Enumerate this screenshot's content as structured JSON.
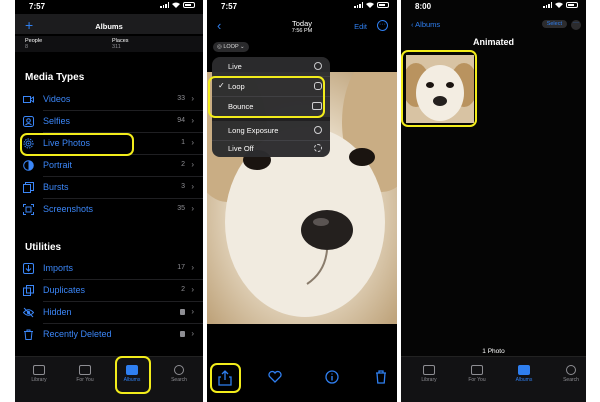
{
  "phone1": {
    "status_time": "7:57",
    "nav_title": "Albums",
    "summary": [
      {
        "label": "People",
        "value": "8"
      },
      {
        "label": "Places",
        "value": "311"
      }
    ],
    "media_types_title": "Media Types",
    "media_types": [
      {
        "label": "Videos",
        "count": "33"
      },
      {
        "label": "Selfies",
        "count": "94"
      },
      {
        "label": "Live Photos",
        "count": "1"
      },
      {
        "label": "Portrait",
        "count": "2"
      },
      {
        "label": "Bursts",
        "count": "3"
      },
      {
        "label": "Screenshots",
        "count": "35"
      }
    ],
    "utilities_title": "Utilities",
    "utilities": [
      {
        "label": "Imports",
        "count": "17"
      },
      {
        "label": "Duplicates",
        "count": "2"
      },
      {
        "label": "Hidden",
        "count": ""
      },
      {
        "label": "Recently Deleted",
        "count": ""
      }
    ],
    "tabs": [
      "Library",
      "For You",
      "Albums",
      "Search"
    ]
  },
  "phone2": {
    "status_time": "7:57",
    "title": "Today",
    "time": "7:56 PM",
    "edit_label": "Edit",
    "badge": "LOOP",
    "menu": [
      "Live",
      "Loop",
      "Bounce",
      "Long Exposure",
      "Live Off"
    ],
    "selected": "Loop"
  },
  "phone3": {
    "status_time": "8:00",
    "back_label": "Albums",
    "select_label": "Select",
    "album_title": "Animated",
    "photo_count": "1 Photo",
    "tabs": [
      "Library",
      "For You",
      "Albums",
      "Search"
    ]
  },
  "colors": {
    "accent": "#2f7ff0",
    "highlight": "#f2ec1b",
    "background": "#000000"
  }
}
